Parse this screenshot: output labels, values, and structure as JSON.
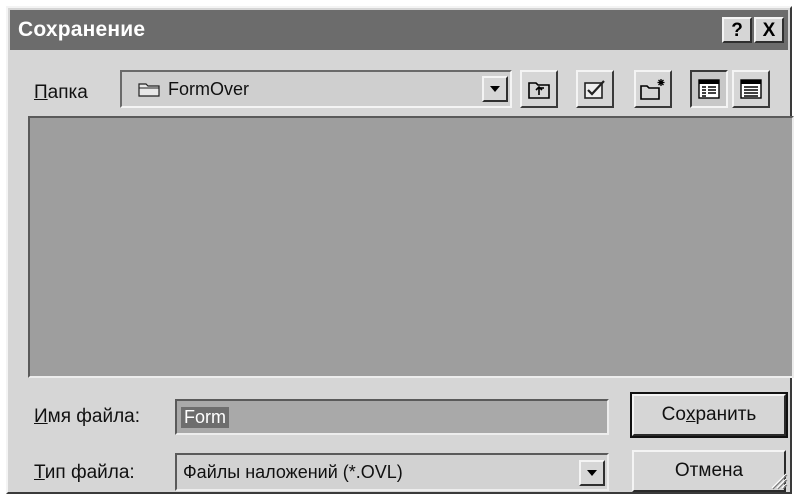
{
  "window": {
    "title": "Сохранение",
    "help_glyph": "?",
    "close_glyph": "X"
  },
  "folder": {
    "label_accel": "П",
    "label_rest": "апка",
    "value": "FormOver"
  },
  "toolbar": {
    "icons": [
      "up-one-level-icon",
      "desktop-icon",
      "new-folder-icon",
      "list-view-icon",
      "details-view-icon"
    ]
  },
  "filename": {
    "label_accel": "И",
    "label_rest": "мя файла:",
    "value": "Form"
  },
  "filetype": {
    "label_accel": "Т",
    "label_rest": "ип файла:",
    "value": "Файлы наложений (*.OVL)"
  },
  "buttons": {
    "save_pre": "Со",
    "save_accel": "х",
    "save_post": "ранить",
    "cancel": "Отмена"
  },
  "colors": {
    "titlebar": "#6c6c6c",
    "face": "#d6d6d6",
    "list_bg": "#9e9e9e",
    "selection": "#6e6e6e"
  }
}
